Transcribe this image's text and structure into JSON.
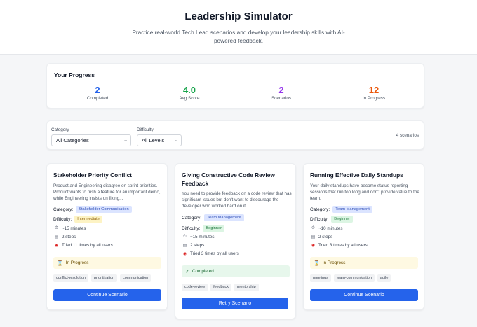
{
  "header": {
    "title": "Leadership Simulator",
    "subtitle": "Practice real-world Tech Lead scenarios and develop your leadership skills with AI-powered feedback."
  },
  "progress": {
    "title": "Your Progress",
    "stats": [
      {
        "value": "2",
        "label": "Completed",
        "color": "#2563eb"
      },
      {
        "value": "4.0",
        "label": "Avg Score",
        "color": "#16a34a"
      },
      {
        "value": "2",
        "label": "Scenarios",
        "color": "#9333ea"
      },
      {
        "value": "12",
        "label": "In Progress",
        "color": "#ea580c"
      }
    ]
  },
  "filters": {
    "category_label": "Category",
    "category_value": "All Categories",
    "difficulty_label": "Difficulty",
    "difficulty_value": "All Levels",
    "count": "4 scenarios"
  },
  "labels": {
    "category": "Category:",
    "difficulty": "Difficulty:"
  },
  "scenarios": [
    {
      "title": "Stakeholder Priority Conflict",
      "description": "Product and Engineering disagree on sprint priorities. Product wants to rush a feature for an important demo, while Engineering insists on fixing...",
      "category": "Stakeholder Communication",
      "difficulty": "Intermediate",
      "duration": "~15 minutes",
      "steps": "2 steps",
      "tried": "Tried 11 times by all users",
      "status": "In Progress",
      "tags": [
        "conflict-resolution",
        "prioritization",
        "communication"
      ],
      "button": "Continue Scenario"
    },
    {
      "title": "Giving Constructive Code Review Feedback",
      "description": "You need to provide feedback on a code review that has significant issues but don't want to discourage the developer who worked hard on it.",
      "category": "Team Management",
      "difficulty": "Beginner",
      "duration": "~15 minutes",
      "steps": "2 steps",
      "tried": "Tried 3 times by all users",
      "status": "Completed",
      "tags": [
        "code-review",
        "feedback",
        "mentorship"
      ],
      "button": "Retry Scenario"
    },
    {
      "title": "Running Effective Daily Standups",
      "description": "Your daily standups have become status reporting sessions that run too long and don't provide value to the team.",
      "category": "Team Management",
      "difficulty": "Beginner",
      "duration": "~10 minutes",
      "steps": "2 steps",
      "tried": "Tried 3 times by all users",
      "status": "In Progress",
      "tags": [
        "meetings",
        "team-communication",
        "agile"
      ],
      "button": "Continue Scenario"
    }
  ]
}
